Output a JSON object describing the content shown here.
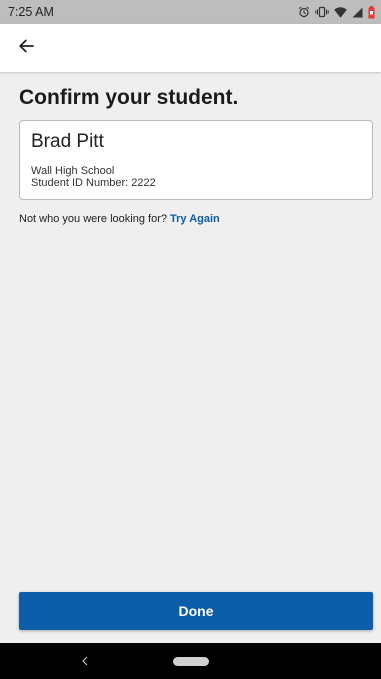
{
  "status_bar": {
    "time": "7:25 AM",
    "icons": [
      "alarm-icon",
      "vibrate-icon",
      "wifi-icon",
      "signal-icon",
      "battery-icon"
    ]
  },
  "app_bar": {
    "back_icon": "arrow-left-icon"
  },
  "main": {
    "title": "Confirm your student.",
    "student": {
      "name": "Brad Pitt",
      "school": "Wall High School",
      "id_line": "Student ID Number: 2222"
    },
    "not_who_text": "Not who you were looking for? ",
    "try_again_label": "Try Again"
  },
  "footer": {
    "done_label": "Done"
  },
  "nav_bar": {
    "back_icon": "nav-back-icon",
    "home_icon": "nav-home-pill-icon"
  },
  "colors": {
    "accent": "#0c5ea8",
    "link": "#0d5ca6",
    "background": "#efefef",
    "status_bar": "#bdbdbd",
    "battery": "#e53935"
  }
}
